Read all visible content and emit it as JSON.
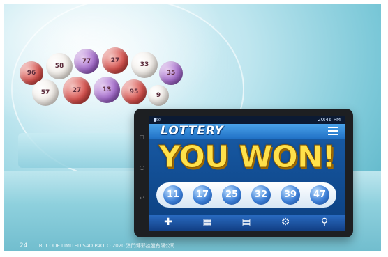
{
  "tablet": {
    "status_time": "20:46 PM",
    "title": "LOTTERY",
    "headline": "YOU WON!",
    "numbers": [
      "11",
      "17",
      "25",
      "32",
      "39",
      "47"
    ],
    "nav": [
      {
        "icon": "plus-icon",
        "glyph": "✚"
      },
      {
        "icon": "chart-icon",
        "glyph": "▦"
      },
      {
        "icon": "calendar-icon",
        "glyph": "▤"
      },
      {
        "icon": "gear-icon",
        "glyph": "⚙"
      },
      {
        "icon": "search-icon",
        "glyph": "⚲"
      }
    ]
  },
  "drum_balls": [
    "96",
    "58",
    "77",
    "27",
    "33",
    "35",
    "57",
    "27",
    "13",
    "95",
    "9"
  ],
  "footer": {
    "page": "24",
    "text": "BUCODE LIMITED SAO PAOLO 2020   澳門博彩控股有限公司"
  }
}
